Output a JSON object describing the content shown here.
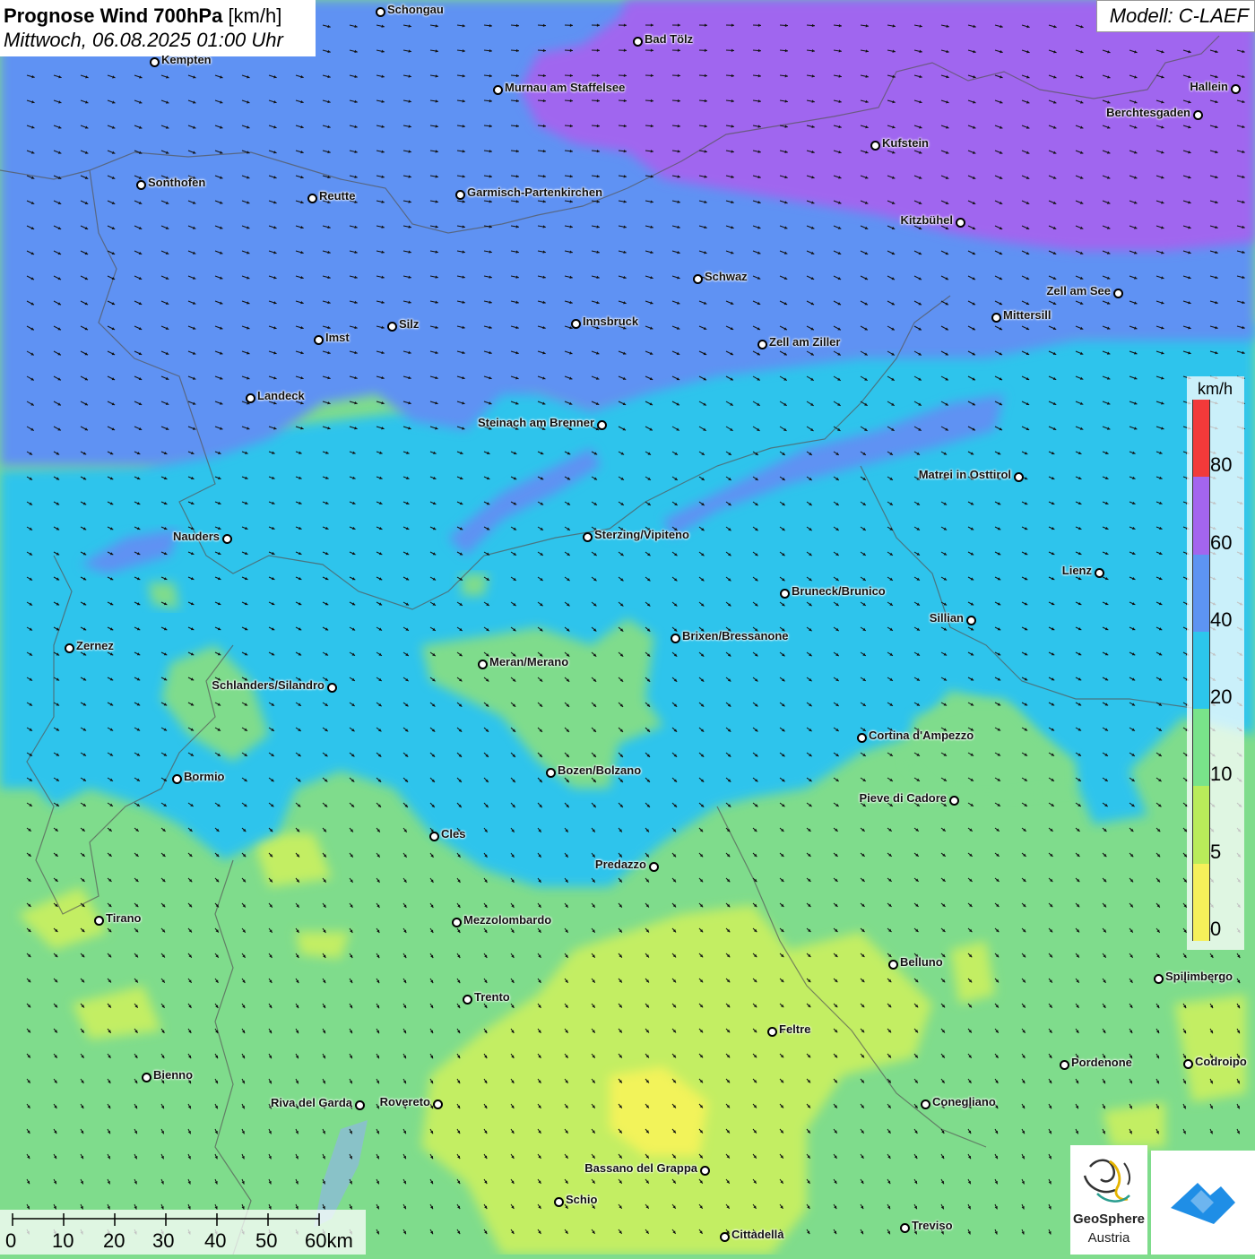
{
  "title": {
    "bold": "Prognose Wind 700hPa",
    "unit": "[km/h]",
    "datetime": "Mittwoch, 06.08.2025 01:00 Uhr"
  },
  "model": "Modell: C-LAEF",
  "legend": {
    "unit": "km/h",
    "bands": [
      {
        "from": 0,
        "to": 5,
        "color": "#f5f05a"
      },
      {
        "from": 5,
        "to": 10,
        "color": "#b9ec5a"
      },
      {
        "from": 10,
        "to": 20,
        "color": "#79e38a"
      },
      {
        "from": 20,
        "to": 40,
        "color": "#2cc6ec"
      },
      {
        "from": 40,
        "to": 60,
        "color": "#5d94f2"
      },
      {
        "from": 60,
        "to": 80,
        "color": "#a365ee"
      },
      {
        "from": 80,
        "to": 100,
        "color": "#f23a3a"
      }
    ],
    "labels": [
      "0",
      "5",
      "10",
      "20",
      "40",
      "60",
      "80"
    ]
  },
  "scalebar": {
    "labels": [
      "0",
      "10",
      "20",
      "30",
      "40",
      "50",
      "60km"
    ]
  },
  "logos": {
    "geosphere_line1": "GeoSphere",
    "geosphere_line2": "Austria",
    "brand_color": "#1f8ee6"
  },
  "cities": [
    {
      "name": "Schongau",
      "id": "schongau"
    },
    {
      "name": "Bad Tölz",
      "id": "bad-toelz"
    },
    {
      "name": "Kempten",
      "id": "kempten"
    },
    {
      "name": "Murnau am Staffelsee",
      "id": "murnau"
    },
    {
      "name": "Hallein",
      "id": "hallein"
    },
    {
      "name": "Berchtesgaden",
      "id": "berchtesgaden"
    },
    {
      "name": "Kufstein",
      "id": "kufstein"
    },
    {
      "name": "Sonthofen",
      "id": "sonthofen"
    },
    {
      "name": "Reutte",
      "id": "reutte"
    },
    {
      "name": "Garmisch-Partenkirchen",
      "id": "garmisch"
    },
    {
      "name": "Kitzbühel",
      "id": "kitzbuehel"
    },
    {
      "name": "Schwaz",
      "id": "schwaz"
    },
    {
      "name": "Zell am See",
      "id": "zell-am-see"
    },
    {
      "name": "Mittersill",
      "id": "mittersill"
    },
    {
      "name": "Silz",
      "id": "silz"
    },
    {
      "name": "Innsbruck",
      "id": "innsbruck"
    },
    {
      "name": "Imst",
      "id": "imst"
    },
    {
      "name": "Zell am Ziller",
      "id": "zell-am-ziller"
    },
    {
      "name": "Landeck",
      "id": "landeck"
    },
    {
      "name": "Steinach am Brenner",
      "id": "steinach"
    },
    {
      "name": "Matrei in Osttirol",
      "id": "matrei"
    },
    {
      "name": "Nauders",
      "id": "nauders"
    },
    {
      "name": "Sterzing/Vipiteno",
      "id": "sterzing"
    },
    {
      "name": "Lienz",
      "id": "lienz"
    },
    {
      "name": "Bruneck/Brunico",
      "id": "bruneck"
    },
    {
      "name": "Sillian",
      "id": "sillian"
    },
    {
      "name": "Zernez",
      "id": "zernez"
    },
    {
      "name": "Brixen/Bressanone",
      "id": "brixen"
    },
    {
      "name": "Meran/Merano",
      "id": "meran"
    },
    {
      "name": "Schlanders/Silandro",
      "id": "schlanders"
    },
    {
      "name": "Cortina d'Ampezzo",
      "id": "cortina"
    },
    {
      "name": "Bozen/Bolzano",
      "id": "bozen"
    },
    {
      "name": "Bormio",
      "id": "bormio"
    },
    {
      "name": "Pieve di Cadore",
      "id": "pieve"
    },
    {
      "name": "Cles",
      "id": "cles"
    },
    {
      "name": "Predazzo",
      "id": "predazzo"
    },
    {
      "name": "Tirano",
      "id": "tirano"
    },
    {
      "name": "Mezzolombardo",
      "id": "mezzolombardo"
    },
    {
      "name": "Belluno",
      "id": "belluno"
    },
    {
      "name": "Spilimbergo",
      "id": "spilimbergo"
    },
    {
      "name": "Trento",
      "id": "trento"
    },
    {
      "name": "Feltre",
      "id": "feltre"
    },
    {
      "name": "Pordenone",
      "id": "pordenone"
    },
    {
      "name": "Codroipo",
      "id": "codroipo"
    },
    {
      "name": "Bienno",
      "id": "bienno"
    },
    {
      "name": "Riva del Garda",
      "id": "riva"
    },
    {
      "name": "Rovereto",
      "id": "rovereto"
    },
    {
      "name": "Conegliano",
      "id": "conegliano"
    },
    {
      "name": "Bassano del Grappa",
      "id": "bassano"
    },
    {
      "name": "Schio",
      "id": "schio"
    },
    {
      "name": "Treviso",
      "id": "treviso"
    },
    {
      "name": "Cittadella",
      "id": "cittadella"
    }
  ]
}
